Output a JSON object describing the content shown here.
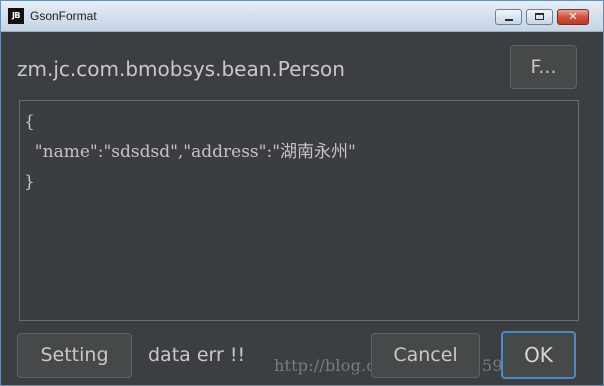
{
  "window": {
    "app_icon_text": "JB",
    "title": "GsonFormat",
    "controls": {
      "minimize": "minimize-icon",
      "maximize": "maximize-icon",
      "close": "close-icon"
    }
  },
  "header": {
    "class_name": "zm.jc.com.bmobsys.bean.Person",
    "format_button_label": "F..."
  },
  "editor": {
    "lines": [
      "{",
      "  \"name\":\"sdsdsd\",\"address\":\"湖南永州\"",
      "}"
    ]
  },
  "footer": {
    "setting_label": "Setting",
    "status_text": "data err !!",
    "cancel_label": "Cancel",
    "ok_label": "OK"
  },
  "watermark": {
    "text": "http://blog.csdn.net/qq_15950325"
  },
  "colors": {
    "background": "#3c3f41",
    "text": "#c8c8c8",
    "focus_border": "#4f88c4"
  }
}
